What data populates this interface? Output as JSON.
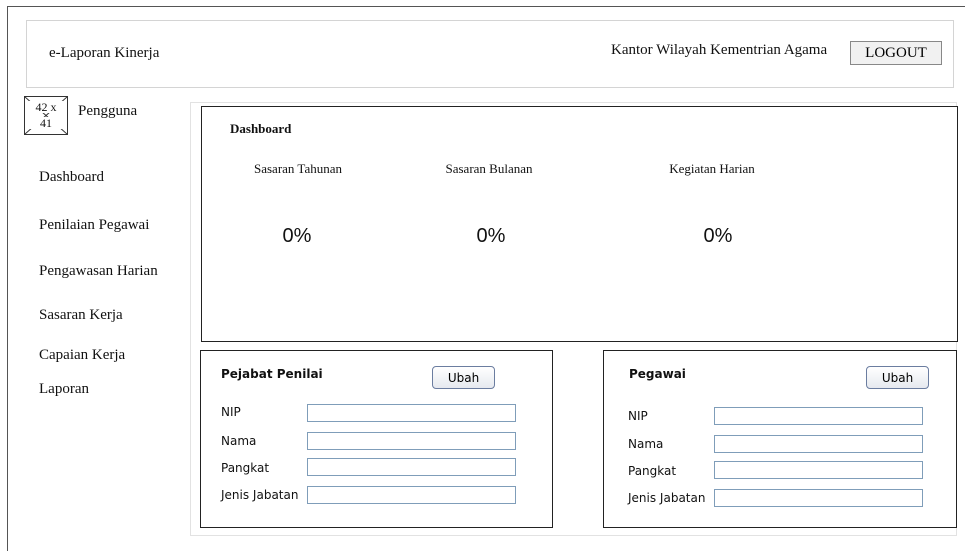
{
  "header": {
    "app_title": "e-Laporan Kinerja",
    "organization": "Kantor Wilayah Kementrian Agama",
    "logout_label": "LOGOUT"
  },
  "user": {
    "avatar_placeholder_line1": "42 x",
    "avatar_placeholder_line2": "41",
    "name": "Pengguna"
  },
  "nav": {
    "items": [
      {
        "label": "Dashboard"
      },
      {
        "label": "Penilaian Pegawai"
      },
      {
        "label": "Pengawasan Harian"
      },
      {
        "label": "Sasaran Kerja"
      },
      {
        "label": "Capaian Kerja"
      },
      {
        "label": "Laporan"
      }
    ]
  },
  "dashboard": {
    "title": "Dashboard",
    "metrics": [
      {
        "label": "Sasaran Tahunan",
        "value": "0%"
      },
      {
        "label": "Sasaran Bulanan",
        "value": "0%"
      },
      {
        "label": "Kegiatan Harian",
        "value": "0%"
      }
    ]
  },
  "pejabat_penilai": {
    "title": "Pejabat Penilai",
    "edit_label": "Ubah",
    "fields": [
      {
        "label": "NIP",
        "value": ""
      },
      {
        "label": "Nama",
        "value": ""
      },
      {
        "label": "Pangkat",
        "value": ""
      },
      {
        "label": "Jenis Jabatan",
        "value": ""
      }
    ]
  },
  "pegawai": {
    "title": "Pegawai",
    "edit_label": "Ubah",
    "fields": [
      {
        "label": "NIP",
        "value": ""
      },
      {
        "label": "Nama",
        "value": ""
      },
      {
        "label": "Pangkat",
        "value": ""
      },
      {
        "label": "Jenis Jabatan",
        "value": ""
      }
    ]
  }
}
